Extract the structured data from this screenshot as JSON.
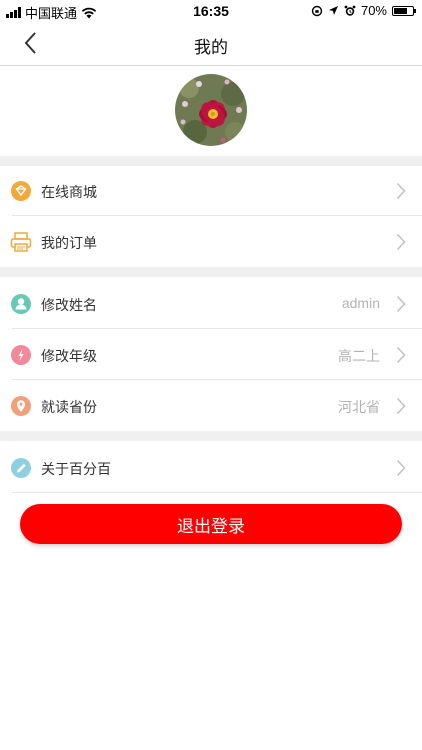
{
  "status_bar": {
    "carrier": "中国联通",
    "time": "16:35",
    "battery": "70%",
    "battery_level": 0.7
  },
  "header": {
    "title": "我的",
    "back_icon": "chevron-left-icon"
  },
  "profile": {
    "avatar_icon": "flower-avatar"
  },
  "groups": [
    {
      "items": [
        {
          "label": "在线商城",
          "icon": "shop-icon",
          "icon_color": "#f0a93a"
        },
        {
          "label": "我的订单",
          "icon": "printer-icon",
          "icon_color": "#f0a93a"
        }
      ]
    },
    {
      "items": [
        {
          "label": "修改姓名",
          "value": "admin",
          "icon": "person-icon",
          "icon_color": "#66c9b6"
        },
        {
          "label": "修改年级",
          "value": "高二上",
          "icon": "edit-grade-icon",
          "icon_color": "#f08a9a"
        },
        {
          "label": "就读省份",
          "value": "河北省",
          "icon": "location-icon",
          "icon_color": "#f0a07a"
        }
      ]
    },
    {
      "items": [
        {
          "label": "关于百分百",
          "icon": "pencil-icon",
          "icon_color": "#8fd0e0"
        }
      ]
    }
  ],
  "logout_label": "退出登录",
  "colors": {
    "logout_bg": "#ff0000",
    "section_gap": "#f0f0f0",
    "value_text": "#b3b3b3"
  }
}
